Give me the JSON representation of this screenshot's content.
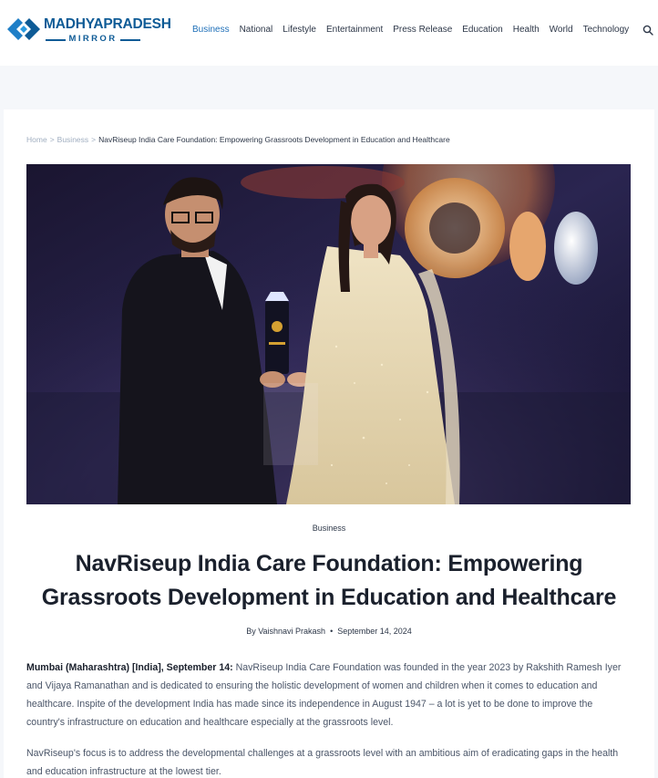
{
  "site": {
    "logo_title": "MADHYAPRADESH",
    "logo_subtitle": "MIRROR",
    "brand_color": "#0e5b96"
  },
  "nav": {
    "items": [
      {
        "label": "Business",
        "active": true
      },
      {
        "label": "National"
      },
      {
        "label": "Lifestyle"
      },
      {
        "label": "Entertainment"
      },
      {
        "label": "Press Release"
      },
      {
        "label": "Education"
      },
      {
        "label": "Health"
      },
      {
        "label": "World"
      },
      {
        "label": "Technology"
      }
    ],
    "search_icon": "search-icon",
    "active_color": "#1e6fb8"
  },
  "breadcrumb": {
    "home": "Home",
    "section": "Business",
    "separator": ">",
    "current": "NavRiseup India Care Foundation: Empowering Grassroots Development in Education and Healthcare"
  },
  "article": {
    "category": "Business",
    "title": "NavRiseup India Care Foundation: Empowering Grassroots Development in Education and Healthcare",
    "author": "By Vaishnavi Prakash",
    "date": "September 14, 2024",
    "dateline": "Mumbai (Maharashtra) [India], September 14:",
    "paragraph1": " NavRiseup India Care Foundation was founded in the year 2023 by Rakshith Ramesh Iyer and Vijaya Ramanathan and is dedicated to ensuring the holistic development of women and children when it comes to education and healthcare. Inspite of the development India has made since its independence in August 1947 – a lot is yet to be done to improve the country's infrastructure on education and healthcare especially at the grassroots level.",
    "paragraph2": "NavRiseup's focus is to address the developmental challenges at a grassroots level with an ambitious aim of eradicating gaps in the health and education infrastructure at the lowest tier."
  }
}
